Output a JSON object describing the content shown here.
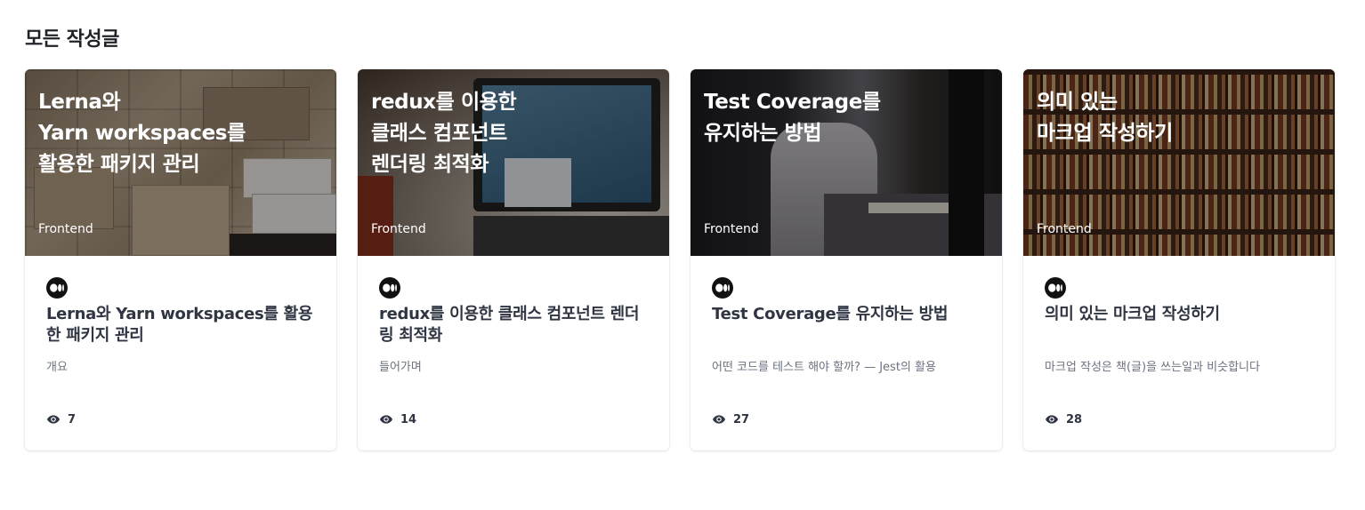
{
  "section": {
    "title": "모든 작성글"
  },
  "posts": [
    {
      "cover_title": "Lerna와\nYarn workspaces를\n활용한 패키지 관리",
      "category": "Frontend",
      "title": "Lerna와 Yarn workspaces를 활용한 패키지 관리",
      "excerpt": "개요",
      "views": "7"
    },
    {
      "cover_title": "redux를 이용한\n클래스 컴포넌트\n렌더링 최적화",
      "category": "Frontend",
      "title": "redux를 이용한 클래스 컴포넌트 렌더링 최적화",
      "excerpt": "들어가며",
      "views": "14"
    },
    {
      "cover_title": "Test Coverage를\n유지하는 방법",
      "category": "Frontend",
      "title": "Test Coverage를 유지하는 방법",
      "excerpt": "어떤 코드를 테스트 해야 할까? — Jest의 활용",
      "views": "27"
    },
    {
      "cover_title": "의미 있는\n마크업 작성하기",
      "category": "Frontend",
      "title": "의미 있는 마크업 작성하기",
      "excerpt": "마크업 작성은 책(글)을 쓰는일과 비슷합니다",
      "views": "28"
    }
  ],
  "icons": {
    "avatar": "medium-logo-icon",
    "views": "eye-icon"
  },
  "colors": {
    "title": "#2f3542",
    "excerpt": "#6b7280",
    "overlay_text": "#ffffff"
  }
}
